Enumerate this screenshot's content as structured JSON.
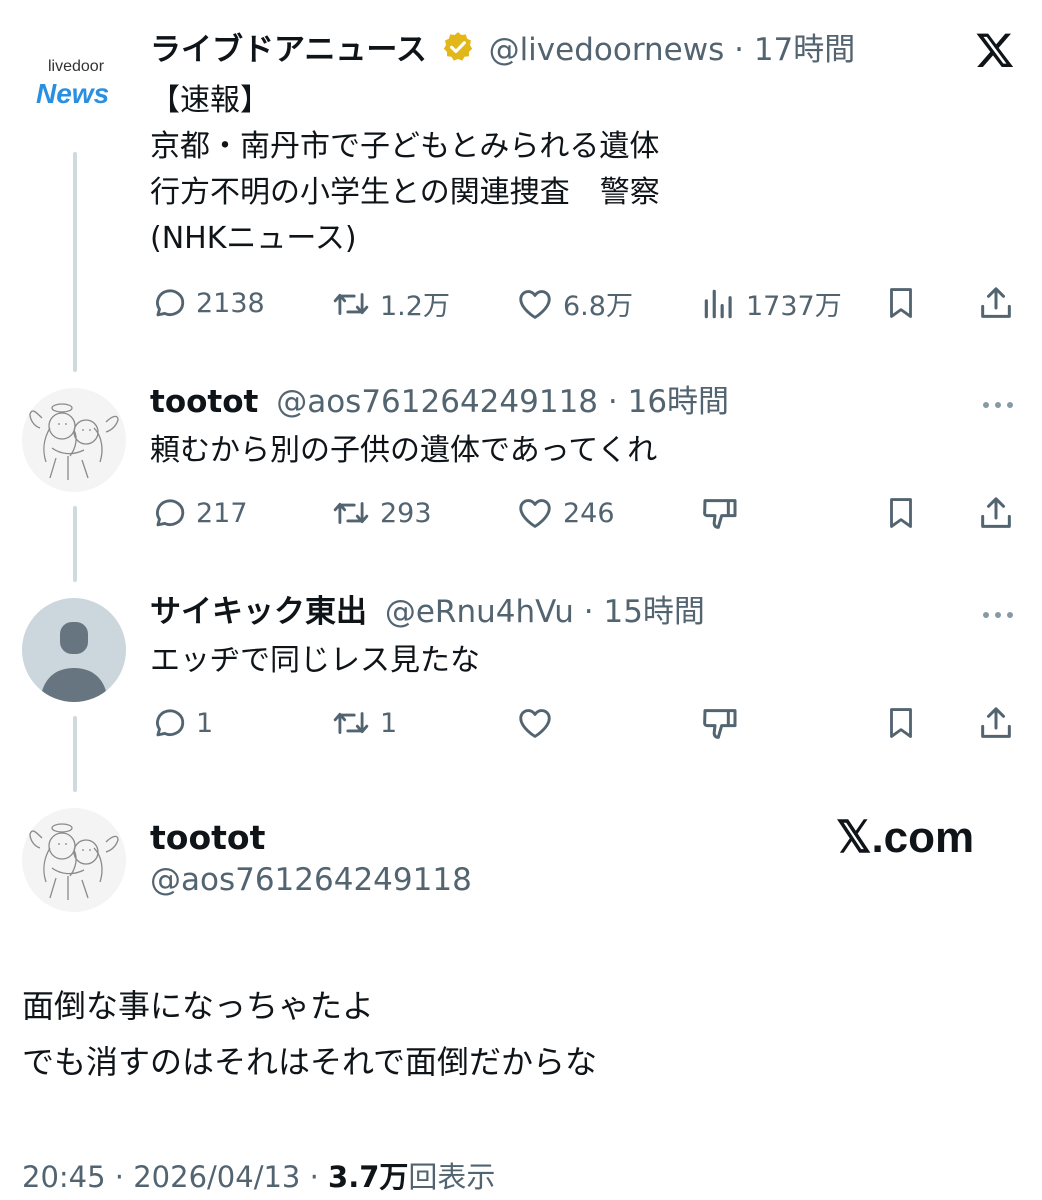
{
  "post1": {
    "avatar_top": "livedoor",
    "avatar_bottom": "News",
    "name": "ライブドアニュース",
    "handle": "@livedoornews",
    "sep": "·",
    "time": "17時間",
    "lines": [
      "【速報】",
      "京都・南丹市で子どもとみられる遺体",
      "行方不明の小学生との関連捜査　警察",
      "(NHKニュース)"
    ],
    "replies": "2138",
    "reposts": "1.2万",
    "likes": "6.8万",
    "views": "1737万"
  },
  "post2": {
    "name": "tootot",
    "handle": "@aos761264249118",
    "sep": "·",
    "time": "16時間",
    "text": "頼むから別の子供の遺体であってくれ",
    "replies": "217",
    "reposts": "293",
    "likes": "246"
  },
  "post3": {
    "name": "サイキック東出",
    "handle": "@eRnu4hVu",
    "sep": "·",
    "time": "15時間",
    "text": "エッヂで同じレス見たな",
    "replies": "1",
    "reposts": "1"
  },
  "main": {
    "name": "tootot",
    "handle": "@aos761264249118",
    "brand": "𝕏.com",
    "lines": [
      "面倒な事になっちゃたよ",
      "でも消すのはそれはそれで面倒だからな"
    ],
    "time": "20:45",
    "sep1": "·",
    "date": "2026/04/13",
    "sep2": "·",
    "views_count": "3.7万",
    "views_label": "回表示"
  },
  "colors": {
    "text": "#0f1419",
    "muted": "#536471",
    "line": "#cfd9de",
    "verified": "#e2b719",
    "news_blue": "#2b8fe0"
  }
}
